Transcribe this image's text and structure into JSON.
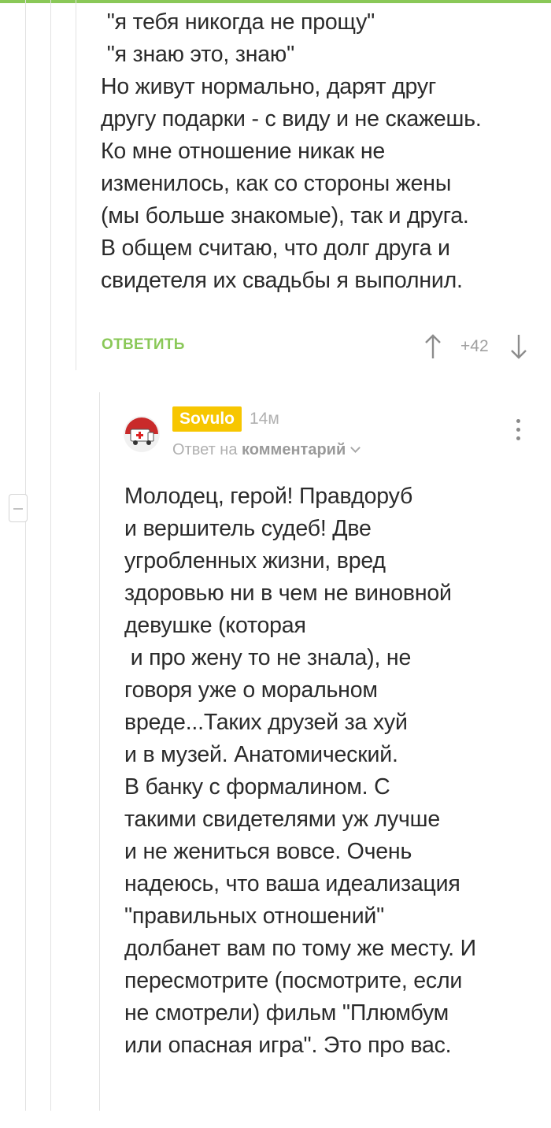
{
  "colors": {
    "accent": "#8ac858",
    "username_badge": "#f7c600",
    "text": "#2b2b2b",
    "muted": "#b0b0b0"
  },
  "parent_comment": {
    "lines": [
      " \"я тебя никогда не прощу\"",
      " \"я знаю это, знаю\"",
      "Но живут нормально, дарят друг",
      "другу подарки - с виду и не скажешь.",
      "Ко мне отношение никак не",
      "изменилось, как со стороны жены",
      "(мы больше знакомые), так и друга.",
      "В общем считаю, что долг друга и",
      "свидетеля их свадьбы я выполнил."
    ],
    "reply_label": "ОТВЕТИТЬ",
    "rating": "+42",
    "upvote_icon": "arrow-up-icon",
    "downvote_icon": "arrow-down-icon"
  },
  "reply_comment": {
    "username": "Sovulo",
    "time": "14м",
    "reply_to_prefix": "Ответ на",
    "reply_to_target": "комментарий",
    "avatar_icon": "ambulance-avatar-icon",
    "menu_icon": "more-vertical-icon",
    "lines": [
      "Молодец, герой! Правдоруб",
      "и вершитель судеб! Две",
      "угробленных жизни, вред",
      "здоровью ни в чем не виновной",
      "девушке (которая",
      " и про жену то не знала), не",
      "говоря уже о моральном",
      "вреде...Таких друзей за хуй",
      "и в музей. Анатомический.",
      "В банку с формалином. С",
      "такими свидетелями уж лучше",
      "и не жениться вовсе. Очень",
      "надеюсь, что ваша идеализация",
      "\"правильных отношений\"",
      "долбанет вам по тому же месту. И",
      "пересмотрите (посмотрите, если",
      "не смотрели) фильм \"Плюмбум",
      "или опасная игра\". Это про вас."
    ]
  }
}
